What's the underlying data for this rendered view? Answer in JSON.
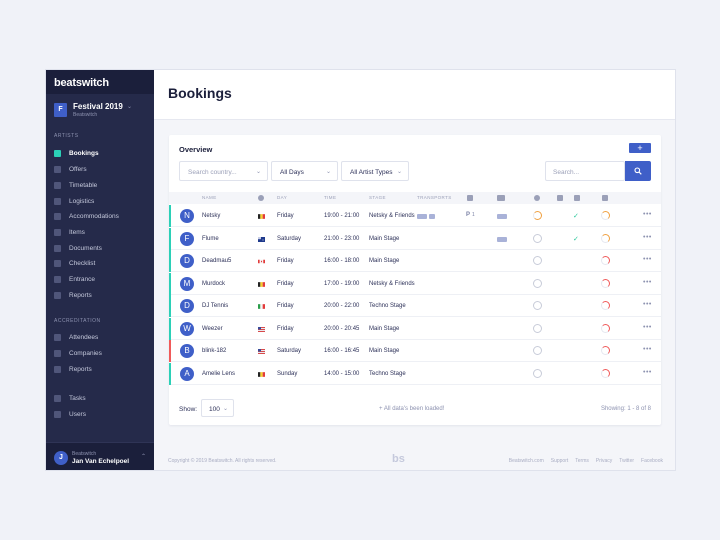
{
  "brand": "beatswitch",
  "event": {
    "badge": "F",
    "name": "Festival 2019",
    "org": "Beatswitch"
  },
  "sidebar": {
    "artists_label": "ARTISTS",
    "artists": [
      "Bookings",
      "Offers",
      "Timetable",
      "Logistics",
      "Accommodations",
      "Items",
      "Documents",
      "Checklist",
      "Entrance",
      "Reports"
    ],
    "accreditation_label": "ACCREDITATION",
    "accreditation": [
      "Attendees",
      "Companies",
      "Reports"
    ],
    "other": [
      "Tasks",
      "Users"
    ]
  },
  "user": {
    "avatar": "J",
    "org": "Beatswitch",
    "name": "Jan Van Echelpoel"
  },
  "page_title": "Bookings",
  "overview": {
    "title": "Overview",
    "add": "+",
    "search_country_placeholder": "Search country...",
    "days_value": "All Days",
    "artist_types_value": "All Artist Types",
    "search_placeholder": "Search..."
  },
  "table": {
    "headers": {
      "name": "NAME",
      "day": "DAY",
      "time": "TIME",
      "stage": "STAGE",
      "transports": "TRANSPORTS"
    },
    "rows": [
      {
        "initial": "N",
        "name": "Netsky",
        "flag": "be",
        "day": "Friday",
        "time": "19:00 - 21:00",
        "stage": "Netsky & Friends",
        "accent": "#2bd0b7",
        "transport": true,
        "parking": "1",
        "accommodation": true,
        "check": true,
        "status_color": "#f0a142"
      },
      {
        "initial": "F",
        "name": "Flume",
        "flag": "au",
        "day": "Saturday",
        "time": "21:00 - 23:00",
        "stage": "Main Stage",
        "accent": "#2bd0b7",
        "transport": false,
        "parking": "",
        "accommodation": true,
        "check": true,
        "status_color": "#f0a142"
      },
      {
        "initial": "D",
        "name": "Deadmau5",
        "flag": "ca",
        "day": "Friday",
        "time": "16:00 - 18:00",
        "stage": "Main Stage",
        "accent": "#2bd0b7",
        "transport": false,
        "parking": "",
        "accommodation": false,
        "check": false,
        "status_color": "#f05a5a"
      },
      {
        "initial": "M",
        "name": "Murdock",
        "flag": "be",
        "day": "Friday",
        "time": "17:00 - 19:00",
        "stage": "Netsky & Friends",
        "accent": "#2bd0b7",
        "transport": false,
        "parking": "",
        "accommodation": false,
        "check": false,
        "status_color": "#f05a5a"
      },
      {
        "initial": "D",
        "name": "DJ Tennis",
        "flag": "it",
        "day": "Friday",
        "time": "20:00 - 22:00",
        "stage": "Techno Stage",
        "accent": "#2bd0b7",
        "transport": false,
        "parking": "",
        "accommodation": false,
        "check": false,
        "status_color": "#f05a5a"
      },
      {
        "initial": "W",
        "name": "Weezer",
        "flag": "us",
        "day": "Friday",
        "time": "20:00 - 20:45",
        "stage": "Main Stage",
        "accent": "#2bd0b7",
        "transport": false,
        "parking": "",
        "accommodation": false,
        "check": false,
        "status_color": "#f05a5a"
      },
      {
        "initial": "B",
        "name": "blink-182",
        "flag": "us",
        "day": "Saturday",
        "time": "16:00 - 16:45",
        "stage": "Main Stage",
        "accent": "#f05a5a",
        "transport": false,
        "parking": "",
        "accommodation": false,
        "check": false,
        "status_color": "#f05a5a"
      },
      {
        "initial": "A",
        "name": "Amelie Lens",
        "flag": "be",
        "day": "Sunday",
        "time": "14:00 - 15:00",
        "stage": "Techno Stage",
        "accent": "#2bd0b7",
        "transport": false,
        "parking": "",
        "accommodation": false,
        "check": false,
        "status_color": "#f05a5a"
      }
    ]
  },
  "footer": {
    "show_label": "Show:",
    "show_value": "100",
    "loaded": "All data's been loaded!",
    "showing": "Showing: 1 - 8 of 8"
  },
  "page_footer": {
    "copyright": "Copyright © 2019 Beatswitch. All rights reserved.",
    "logo": "bs",
    "links": [
      "Beatswitch.com",
      "Support",
      "Terms",
      "Privacy",
      "Twitter",
      "Facebook"
    ]
  }
}
